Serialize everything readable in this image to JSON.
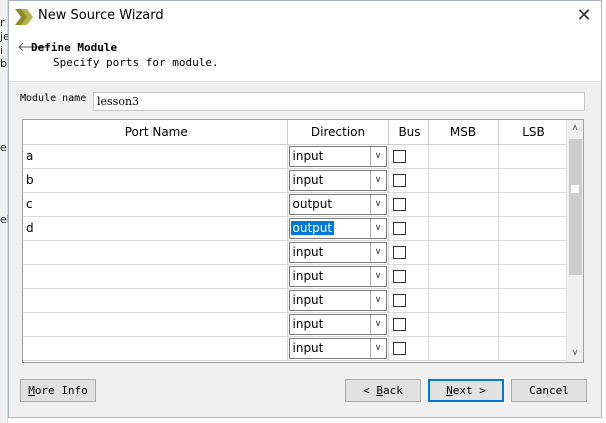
{
  "window": {
    "title": "New Source Wizard"
  },
  "header": {
    "title": "Define Module",
    "subtitle": "Specify ports for module."
  },
  "module": {
    "label": "Module name",
    "value": "lesson3"
  },
  "table": {
    "columns": [
      "Port Name",
      "Direction",
      "Bus",
      "MSB",
      "LSB"
    ],
    "rows": [
      {
        "name": "a",
        "direction": "input",
        "bus": false,
        "msb": "",
        "lsb": ""
      },
      {
        "name": "b",
        "direction": "input",
        "bus": false,
        "msb": "",
        "lsb": ""
      },
      {
        "name": "c",
        "direction": "output",
        "bus": false,
        "msb": "",
        "lsb": ""
      },
      {
        "name": "d",
        "direction": "output",
        "bus": false,
        "msb": "",
        "lsb": "",
        "selected": true
      },
      {
        "name": "",
        "direction": "input",
        "bus": false,
        "msb": "",
        "lsb": ""
      },
      {
        "name": "",
        "direction": "input",
        "bus": false,
        "msb": "",
        "lsb": ""
      },
      {
        "name": "",
        "direction": "input",
        "bus": false,
        "msb": "",
        "lsb": ""
      },
      {
        "name": "",
        "direction": "input",
        "bus": false,
        "msb": "",
        "lsb": ""
      },
      {
        "name": "",
        "direction": "input",
        "bus": false,
        "msb": "",
        "lsb": ""
      }
    ]
  },
  "buttons": {
    "more_info": {
      "mnemonic": "M",
      "rest": "ore Info"
    },
    "back": {
      "prefix": "< ",
      "mnemonic": "B",
      "rest": "ack"
    },
    "next": {
      "mnemonic": "N",
      "rest": "ext >"
    },
    "cancel": {
      "label": "Cancel"
    }
  },
  "background": {
    "glyphs": [
      "r",
      "je",
      "i",
      "b",
      "e",
      "el"
    ]
  },
  "colors": {
    "selection": "#0078d7",
    "accent_icon": "#8b8b2a"
  }
}
